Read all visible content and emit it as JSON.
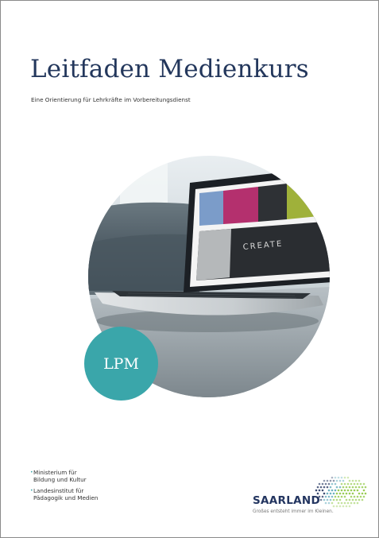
{
  "cover": {
    "title": "Leitfaden Medienkurs",
    "subtitle": "Eine Orientierung für Lehrkräfte im Vorbereitungsdienst",
    "badge": "LPM",
    "screen_text": "CREATE"
  },
  "organizations": [
    {
      "line1": "Ministerium für",
      "line2": "Bildung und Kultur"
    },
    {
      "line1": "Landesinstitut für",
      "line2": "Pädagogik und Medien"
    }
  ],
  "logo": {
    "name": "SAARLAND",
    "slogan": "Großes entsteht immer im Kleinen."
  },
  "colors": {
    "title": "#23375c",
    "teal": "#3aa6aa",
    "logo_blue": "#233560",
    "logo_green": "#8cc63f"
  }
}
